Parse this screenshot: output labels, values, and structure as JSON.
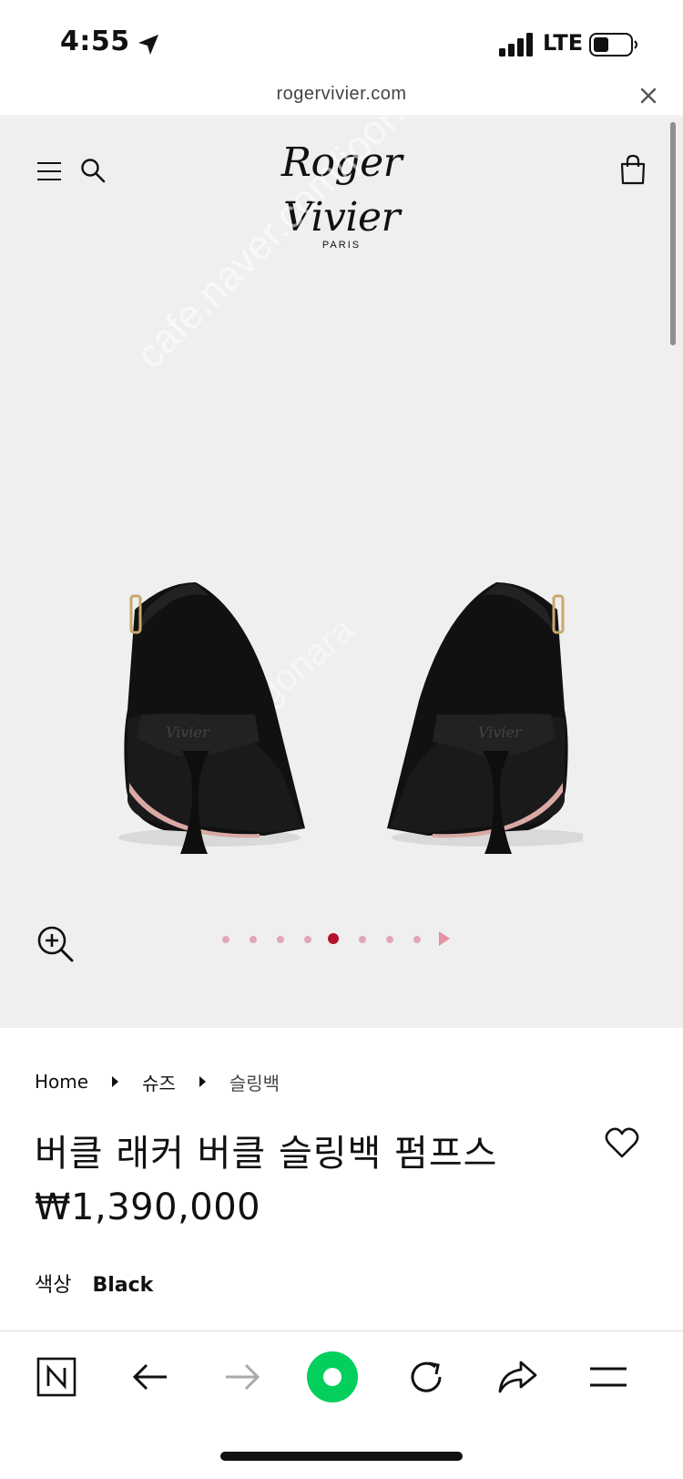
{
  "status_bar": {
    "time": "4:55",
    "network": "LTE"
  },
  "browser": {
    "url": "rogervivier.com"
  },
  "site": {
    "logo_main": "Roger Vivier",
    "logo_sub": "PARIS"
  },
  "gallery": {
    "watermark_text": "cafe.naver.com/joonggonara",
    "watermark_text2": "Joonggonara",
    "image_count": 8,
    "active_index": 4
  },
  "breadcrumb": {
    "home": "Home",
    "category": "슈즈",
    "subcategory": "슬링백"
  },
  "product": {
    "title": "버클 래커 버클 슬링백 펌프스",
    "price": "₩1,390,000",
    "color_label": "색상",
    "color_value": "Black"
  },
  "colors": {
    "accent_dot": "#b5122e",
    "dot_inactive": "#e2a7b5",
    "naver_green": "#03cf5d"
  },
  "toolbar": {
    "icons": [
      "naver-home-icon",
      "back-arrow-icon",
      "forward-arrow-icon",
      "green-dot-icon",
      "reload-icon",
      "share-icon",
      "menu-icon"
    ]
  }
}
